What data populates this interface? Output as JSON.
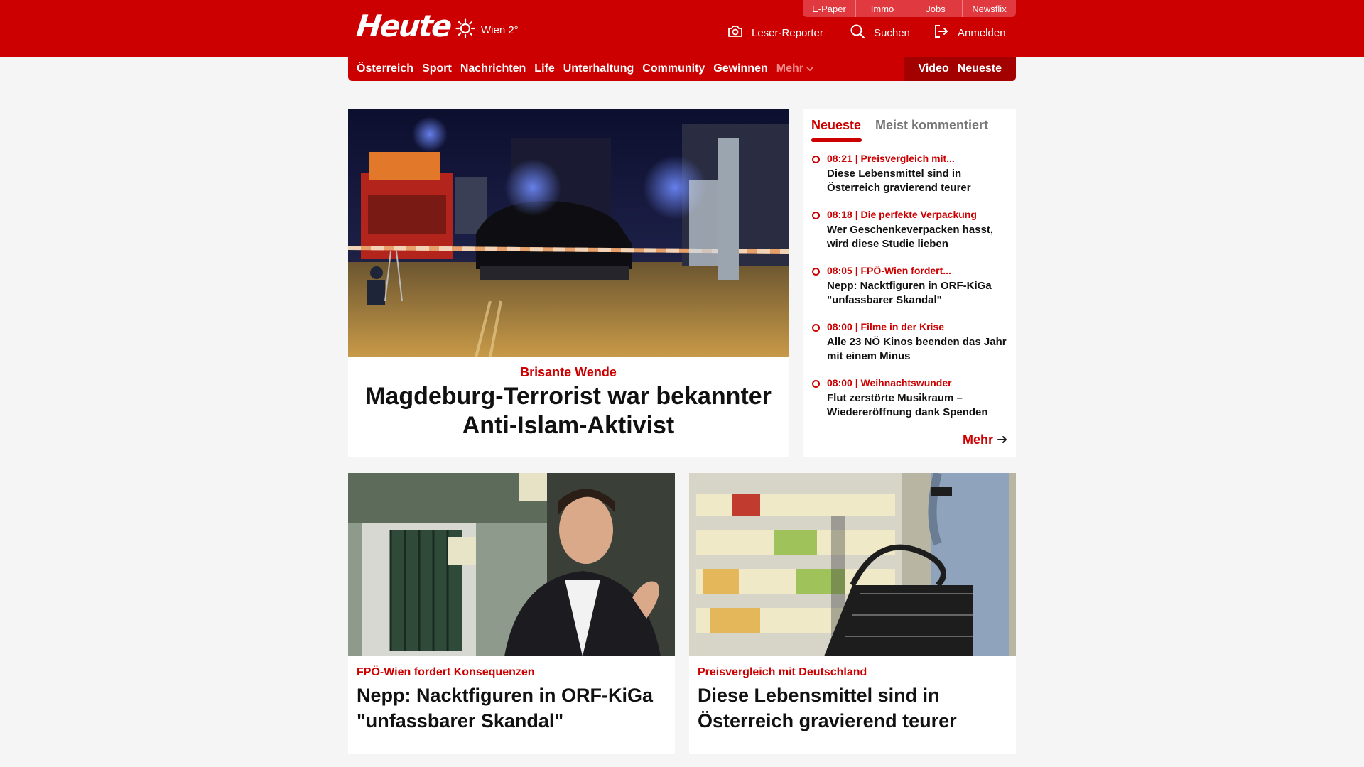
{
  "header": {
    "logo": "Heute",
    "weather": "Wien 2°",
    "services": [
      "E-Paper",
      "Immo",
      "Jobs",
      "Newsflix"
    ],
    "actions": {
      "reporter": "Leser-Reporter",
      "search": "Suchen",
      "login": "Anmelden"
    }
  },
  "nav": {
    "items": [
      "Österreich",
      "Sport",
      "Nachrichten",
      "Life",
      "Unterhaltung",
      "Community",
      "Gewinnen"
    ],
    "more": "Mehr",
    "right": [
      "Video",
      "Neueste"
    ]
  },
  "hero": {
    "kicker": "Brisante Wende",
    "title": "Magdeburg-Terrorist war bekannter Anti-Islam-Aktivist"
  },
  "sidebar": {
    "tabs": [
      "Neueste",
      "Meist kommentiert"
    ],
    "items": [
      {
        "meta": "08:21 | Preisvergleich mit...",
        "title": "Diese Lebensmittel sind in Österreich gravierend teurer"
      },
      {
        "meta": "08:18 | Die perfekte Verpackung",
        "title": "Wer Geschenkeverpacken hasst, wird diese Studie lieben"
      },
      {
        "meta": "08:05 | FPÖ-Wien fordert...",
        "title": "Nepp: Nacktfiguren in ORF-KiGa \"unfassbarer Skandal\""
      },
      {
        "meta": "08:00 | Filme in der Krise",
        "title": "Alle 23 NÖ Kinos beenden das Jahr mit einem Minus"
      },
      {
        "meta": "08:00 | Weihnachtswunder",
        "title": "Flut zerstörte Musikraum – Wiedereröffnung dank Spenden"
      }
    ],
    "more": "Mehr"
  },
  "cards": [
    {
      "kicker": "FPÖ-Wien fordert Konsequenzen",
      "title": "Nepp: Nacktfiguren in ORF-KiGa \"unfassbarer Skandal\""
    },
    {
      "kicker": "Preisvergleich mit Deutschland",
      "title": "Diese Lebensmittel sind in Österreich gravierend teurer"
    }
  ],
  "colors": {
    "brand": "#cc0000",
    "brand_dark": "#a30000",
    "page_bg": "#f5f5f5"
  }
}
